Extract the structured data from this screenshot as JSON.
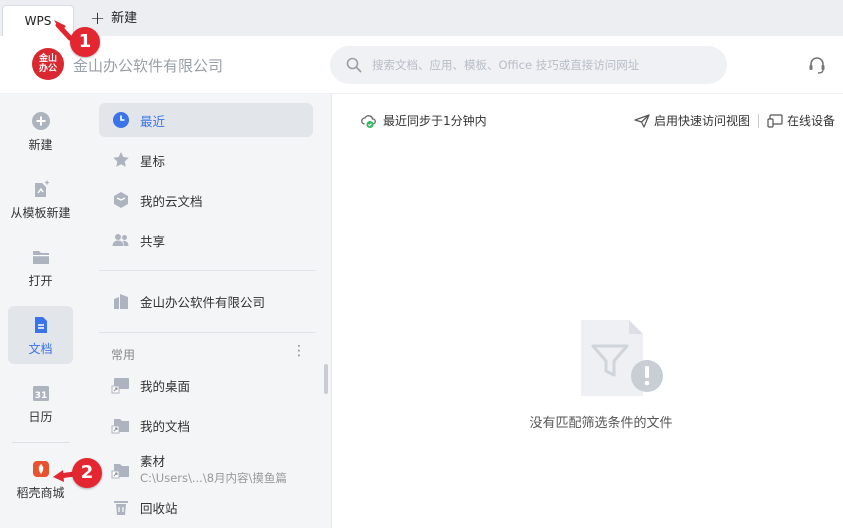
{
  "tabbar": {
    "tab_label": "WPS",
    "new_tab_label": "新建"
  },
  "header": {
    "logo_text": "金山办公",
    "company_name": "金山办公软件有限公司",
    "search_placeholder": "搜索文档、应用、模板、Office 技巧或直接访问网址"
  },
  "leftnav": {
    "items": [
      {
        "label": "新建",
        "icon": "plus-circle-icon"
      },
      {
        "label": "从模板新建",
        "icon": "template-icon"
      },
      {
        "label": "打开",
        "icon": "folder-icon"
      },
      {
        "label": "文档",
        "icon": "document-icon",
        "active": true
      },
      {
        "label": "日历",
        "icon": "calendar-icon",
        "day": "31"
      },
      {
        "label": "稻壳商城",
        "icon": "docer-icon"
      }
    ]
  },
  "sidebar": {
    "items": [
      {
        "label": "最近",
        "icon": "clock-icon",
        "active": true
      },
      {
        "label": "星标",
        "icon": "star-icon"
      },
      {
        "label": "我的云文档",
        "icon": "cloud-doc-icon"
      },
      {
        "label": "共享",
        "icon": "share-icon"
      }
    ],
    "company": {
      "label": "金山办公软件有限公司",
      "icon": "building-icon"
    },
    "section_title": "常用",
    "section_more": "⋮",
    "common": [
      {
        "label": "我的桌面",
        "icon": "desktop-shortcut-icon"
      },
      {
        "label": "我的文档",
        "icon": "folder-shortcut-icon"
      },
      {
        "label": "素材",
        "sub": "C:\\Users\\...\\8月内容\\摸鱼篇",
        "icon": "folder-shortcut-icon"
      },
      {
        "label": "回收站",
        "icon": "trash-icon"
      }
    ]
  },
  "main": {
    "sync_text": "最近同步于1分钟内",
    "quick_access": "启用快速访问视图",
    "online_devices": "在线设备",
    "empty_text": "没有匹配筛选条件的文件"
  },
  "callouts": {
    "one": "1",
    "two": "2"
  },
  "colors": {
    "accent": "#3a74e8",
    "callout": "#e32630",
    "logo": "#d9282f"
  }
}
